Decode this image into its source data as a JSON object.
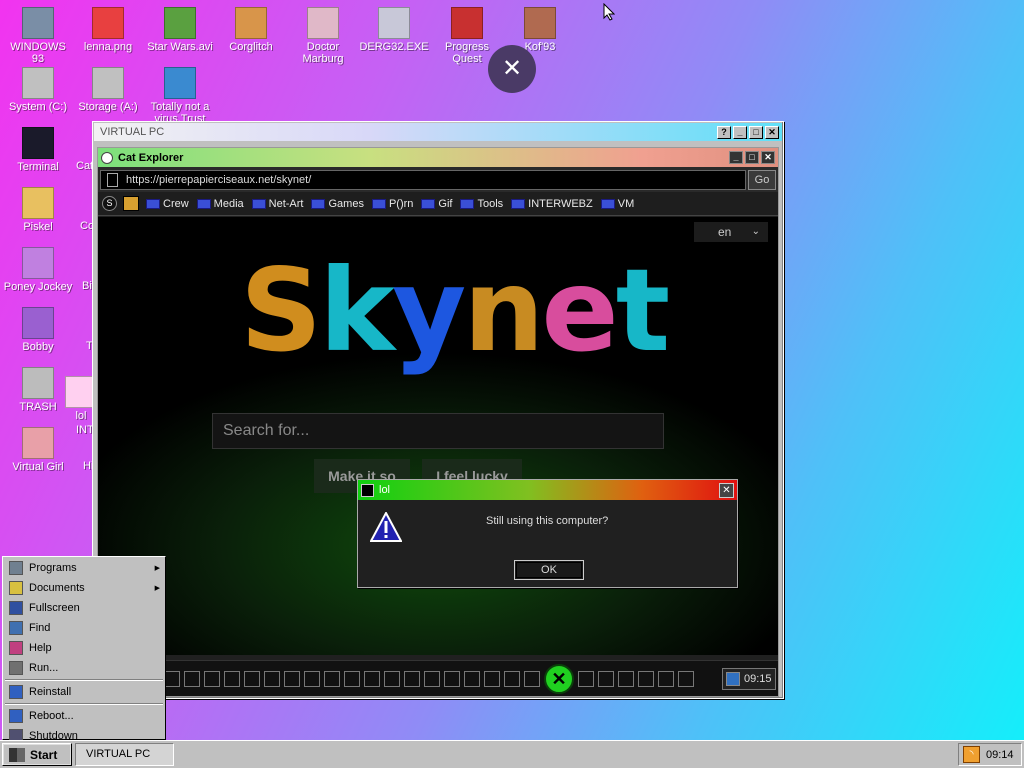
{
  "desktop": {
    "icons": [
      {
        "label": "WINDOWS 93",
        "icon": "computer-icon",
        "color": "#7a8ea6"
      },
      {
        "label": "lenna.png",
        "icon": "image-file-icon",
        "color": "#e84040"
      },
      {
        "label": "Star Wars.avi",
        "icon": "yoda-icon",
        "color": "#5aa040"
      },
      {
        "label": "Corglitch",
        "icon": "corgi-icon",
        "color": "#d8954a"
      },
      {
        "label": "Doctor Marburg",
        "icon": "doctor-icon",
        "color": "#e0b8c8"
      },
      {
        "label": "DERG32.EXE",
        "icon": "terminal-face-icon",
        "color": "#c8c8d8"
      },
      {
        "label": "Progress Quest",
        "icon": "swords-icon",
        "color": "#c83030"
      },
      {
        "label": "Kof'93",
        "icon": "fighter-icon",
        "color": "#b06a50"
      },
      {
        "label": "System (C:)",
        "icon": "drive-icon",
        "color": "#c0c0c0"
      },
      {
        "label": "Storage (A:)",
        "icon": "floppy-drive-icon",
        "color": "#c0c0c0"
      },
      {
        "label": "Totally not a virus.Trust",
        "icon": "dolphin-icon",
        "color": "#3a8ad0"
      },
      {
        "label": "Terminal",
        "icon": "terminal-icon",
        "color": "#1a1a2a"
      },
      {
        "label": "Piskel",
        "icon": "palette-icon",
        "color": "#e8c060"
      },
      {
        "label": "Poney Jockey",
        "icon": "pony-icon",
        "color": "#c080e0"
      },
      {
        "label": "Bobby",
        "icon": "stick-figure-icon",
        "color": "#9a60d0"
      },
      {
        "label": "TRASH",
        "icon": "trash-icon",
        "color": "#bcbcbc"
      },
      {
        "label": "Virtual Girl",
        "icon": "face-icon",
        "color": "#e8a0a8"
      },
      {
        "label": "lol",
        "icon": "blank-file-icon",
        "color": "#ffd0f0"
      }
    ],
    "cut_labels": [
      "Cat",
      "Co",
      "Bi",
      "T",
      "INT",
      "Hi"
    ]
  },
  "close_overlay": {
    "glyph": "✕"
  },
  "cursor": {
    "glyph": "➤"
  },
  "vpc": {
    "title": "VIRTUAL PC",
    "buttons": [
      "?",
      "_",
      "□",
      "✕"
    ]
  },
  "explorer": {
    "title": "Cat Explorer",
    "url": "https://pierrepapierciseaux.net/skynet/",
    "go_label": "Go",
    "bookmarks": [
      "Crew",
      "Media",
      "Net-Art",
      "Games",
      "P()rn",
      "Gif",
      "Tools",
      "INTERWEBZ",
      "VM"
    ],
    "lang": "en",
    "logo_letters": [
      {
        "ch": "S",
        "color": "#d08d1e"
      },
      {
        "ch": "k",
        "color": "#17b7c8"
      },
      {
        "ch": "y",
        "color": "#1d57e0"
      },
      {
        "ch": "n",
        "color": "#c88b22"
      },
      {
        "ch": "e",
        "color": "#d84d9d"
      },
      {
        "ch": "t",
        "color": "#17b7c8"
      }
    ],
    "search_placeholder": "Search for...",
    "btn_make": "Make it so",
    "btn_lucky": "I feel lucky"
  },
  "dialog": {
    "title": "lol",
    "message": "Still using this computer?",
    "ok": "OK"
  },
  "inner_taskbar": {
    "clock": "09:15"
  },
  "start_menu": {
    "items": [
      {
        "label": "Programs",
        "icon": "programs-icon",
        "arrow": true
      },
      {
        "label": "Documents",
        "icon": "documents-icon",
        "arrow": true
      },
      {
        "label": "Fullscreen",
        "icon": "fullscreen-icon",
        "arrow": false
      },
      {
        "label": "Find",
        "icon": "find-icon",
        "arrow": false
      },
      {
        "label": "Help",
        "icon": "help-icon",
        "arrow": false
      },
      {
        "label": "Run...",
        "icon": "run-icon",
        "arrow": false
      },
      {
        "label": "Reinstall",
        "icon": "reinstall-icon",
        "arrow": false
      },
      {
        "label": "Reboot...",
        "icon": "reboot-icon",
        "arrow": false
      },
      {
        "label": "Shutdown",
        "icon": "shutdown-icon",
        "arrow": false
      }
    ]
  },
  "taskbar": {
    "start_label": "Start",
    "task_label": "VIRTUAL PC",
    "clock": "09:14"
  }
}
